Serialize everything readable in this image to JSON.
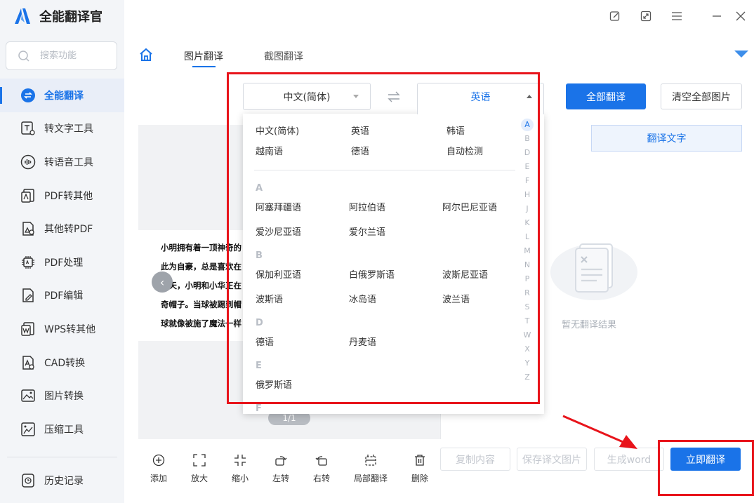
{
  "app": {
    "title": "全能翻译官",
    "brand_color": "#1a73e8",
    "search_placeholder": "搜索功能"
  },
  "sidebar": {
    "items": [
      {
        "label": "全能翻译",
        "icon": "translate-icon",
        "active": true
      },
      {
        "label": "转文字工具",
        "icon": "text-convert-icon"
      },
      {
        "label": "转语音工具",
        "icon": "audio-wave-icon"
      },
      {
        "label": "PDF转其他",
        "icon": "pdf-export-icon"
      },
      {
        "label": "其他转PDF",
        "icon": "pdf-import-icon"
      },
      {
        "label": "PDF处理",
        "icon": "chip-icon"
      },
      {
        "label": "PDF编辑",
        "icon": "edit-doc-icon"
      },
      {
        "label": "WPS转其他",
        "icon": "wps-icon"
      },
      {
        "label": "CAD转换",
        "icon": "cad-icon"
      },
      {
        "label": "图片转换",
        "icon": "image-icon"
      },
      {
        "label": "压缩工具",
        "icon": "compress-icon"
      }
    ],
    "history_label": "历史记录"
  },
  "window_controls": [
    "note-icon",
    "resize-icon",
    "menu-icon",
    "minimize-icon",
    "close-icon"
  ],
  "tabs": [
    {
      "label": "图片翻译",
      "active": true
    },
    {
      "label": "截图翻译",
      "active": false
    }
  ],
  "lang_selector": {
    "source": "中文(简体)",
    "target": "英语"
  },
  "actions": {
    "translate_all": "全部翻译",
    "clear_all": "清空全部图片",
    "copy": "复制内容",
    "save_image": "保存译文图片",
    "gen_word": "生成word",
    "translate_now": "立即翻译"
  },
  "result_tab": "翻译文字",
  "empty_text": "暂无翻译结果",
  "pager": "1/1",
  "image_text": [
    "小明拥有着一顶神奇的",
    "此为自豪，总是喜欢在",
    "这天，小明和小华正在",
    "奇帽子。当球被踢到帽",
    "球就像被施了魔法一样"
  ],
  "toolbar": [
    {
      "label": "添加",
      "icon": "add-icon"
    },
    {
      "label": "放大",
      "icon": "zoom-in-icon"
    },
    {
      "label": "缩小",
      "icon": "zoom-out-icon"
    },
    {
      "label": "左转",
      "icon": "rotate-left-icon"
    },
    {
      "label": "右转",
      "icon": "rotate-right-icon"
    },
    {
      "label": "局部翻译",
      "icon": "partial-translate-icon"
    },
    {
      "label": "删除",
      "icon": "delete-icon"
    }
  ],
  "dropdown": {
    "common": [
      "中文(简体)",
      "英语",
      "韩语",
      "越南语",
      "德语",
      "自动检测"
    ],
    "groups": [
      {
        "letter": "A",
        "items": [
          "阿塞拜疆语",
          "阿拉伯语",
          "阿尔巴尼亚语",
          "爱沙尼亚语",
          "爱尔兰语"
        ]
      },
      {
        "letter": "B",
        "items": [
          "保加利亚语",
          "白俄罗斯语",
          "波斯尼亚语",
          "波斯语",
          "冰岛语",
          "波兰语"
        ]
      },
      {
        "letter": "D",
        "items": [
          "德语",
          "丹麦语"
        ]
      },
      {
        "letter": "E",
        "items": [
          "俄罗斯语"
        ]
      },
      {
        "letter": "F",
        "items": []
      }
    ],
    "alphabet": [
      "A",
      "B",
      "D",
      "E",
      "F",
      "H",
      "J",
      "K",
      "L",
      "M",
      "N",
      "P",
      "R",
      "S",
      "T",
      "W",
      "X",
      "Y",
      "Z"
    ]
  }
}
